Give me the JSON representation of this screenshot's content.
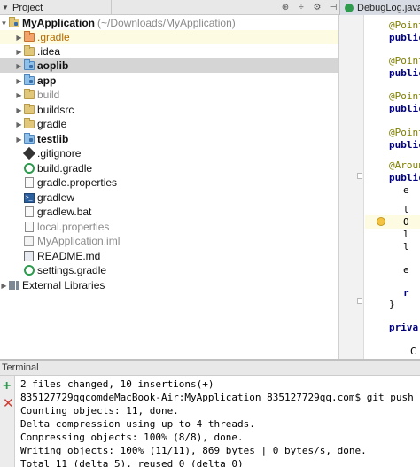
{
  "topbar": {
    "project_label": "Project",
    "editor_tab_label": "DebugLog.java"
  },
  "tree": {
    "root": {
      "name": "MyApplication",
      "path": "(~/Downloads/MyApplication)"
    },
    "items": [
      {
        "label": ".gradle"
      },
      {
        "label": ".idea"
      },
      {
        "label": "aoplib"
      },
      {
        "label": "app"
      },
      {
        "label": "build"
      },
      {
        "label": "buildsrc"
      },
      {
        "label": "gradle"
      },
      {
        "label": "testlib"
      },
      {
        "label": ".gitignore"
      },
      {
        "label": "build.gradle"
      },
      {
        "label": "gradle.properties"
      },
      {
        "label": "gradlew"
      },
      {
        "label": "gradlew.bat"
      },
      {
        "label": "local.properties"
      },
      {
        "label": "MyApplication.iml"
      },
      {
        "label": "README.md"
      },
      {
        "label": "settings.gradle"
      }
    ],
    "external_libraries": "External Libraries"
  },
  "editor": {
    "lines": [
      "@Point",
      "public",
      "@Point",
      "public",
      "@Point",
      "public",
      "@Point",
      "public",
      "@Aroun",
      "public",
      "e",
      "l",
      "O",
      "l",
      "l",
      "e",
      "r",
      "}",
      "priva",
      "C"
    ]
  },
  "terminal": {
    "title": "Terminal",
    "lines": [
      " 2 files changed, 10 insertions(+)",
      "835127729qqcomdeMacBook-Air:MyApplication 835127729qq.com$ git push",
      "Counting objects: 11, done.",
      "Delta compression using up to 4 threads.",
      "Compressing objects: 100% (8/8), done.",
      "Writing objects: 100% (11/11), 869 bytes | 0 bytes/s, done.",
      "Total 11 (delta 5), reused 0 (delta 0)"
    ]
  },
  "colors": {
    "selection": "#d5d5d5",
    "current_line": "#fdfbe1",
    "accent_green": "#2e9a4e",
    "accent_red": "#d23a2e"
  }
}
